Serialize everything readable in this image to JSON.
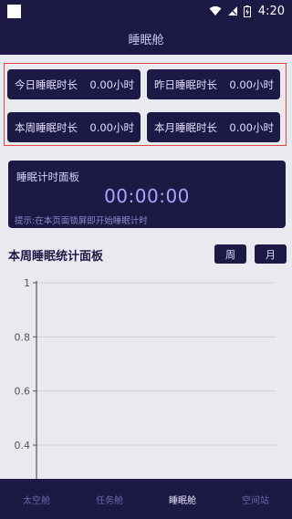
{
  "status_bar": {
    "time": "4:20"
  },
  "header": {
    "title": "睡眠舱"
  },
  "stats": [
    {
      "label": "今日睡眠时长",
      "value": "0.00小时"
    },
    {
      "label": "昨日睡眠时长",
      "value": "0.00小时"
    },
    {
      "label": "本周睡眠时长",
      "value": "0.00小时"
    },
    {
      "label": "本月睡眠时长",
      "value": "0.00小时"
    }
  ],
  "timer": {
    "title": "睡眠计时面板",
    "value": "00:00:00",
    "hint": "提示:在本页面锁屏即开始睡眠计时"
  },
  "board": {
    "title": "本周睡眠统计面板",
    "week_label": "周",
    "month_label": "月"
  },
  "chart_data": {
    "type": "line",
    "y_ticks": [
      "1",
      "0.8",
      "0.6",
      "0.4"
    ],
    "ylim": [
      0.3,
      1
    ],
    "series": [],
    "grid": true,
    "colors": {
      "grid": "#cfcfd8",
      "axis": "#555555",
      "tick_label": "#555555"
    }
  },
  "nav": {
    "items": [
      {
        "label": "太空舱",
        "active": false
      },
      {
        "label": "任务舱",
        "active": false
      },
      {
        "label": "睡眠舱",
        "active": true
      },
      {
        "label": "空间站",
        "active": false
      }
    ]
  },
  "colors": {
    "primary": "#1c1945",
    "highlight_frame": "#e0443c",
    "timer_text": "#a9a3ff"
  }
}
